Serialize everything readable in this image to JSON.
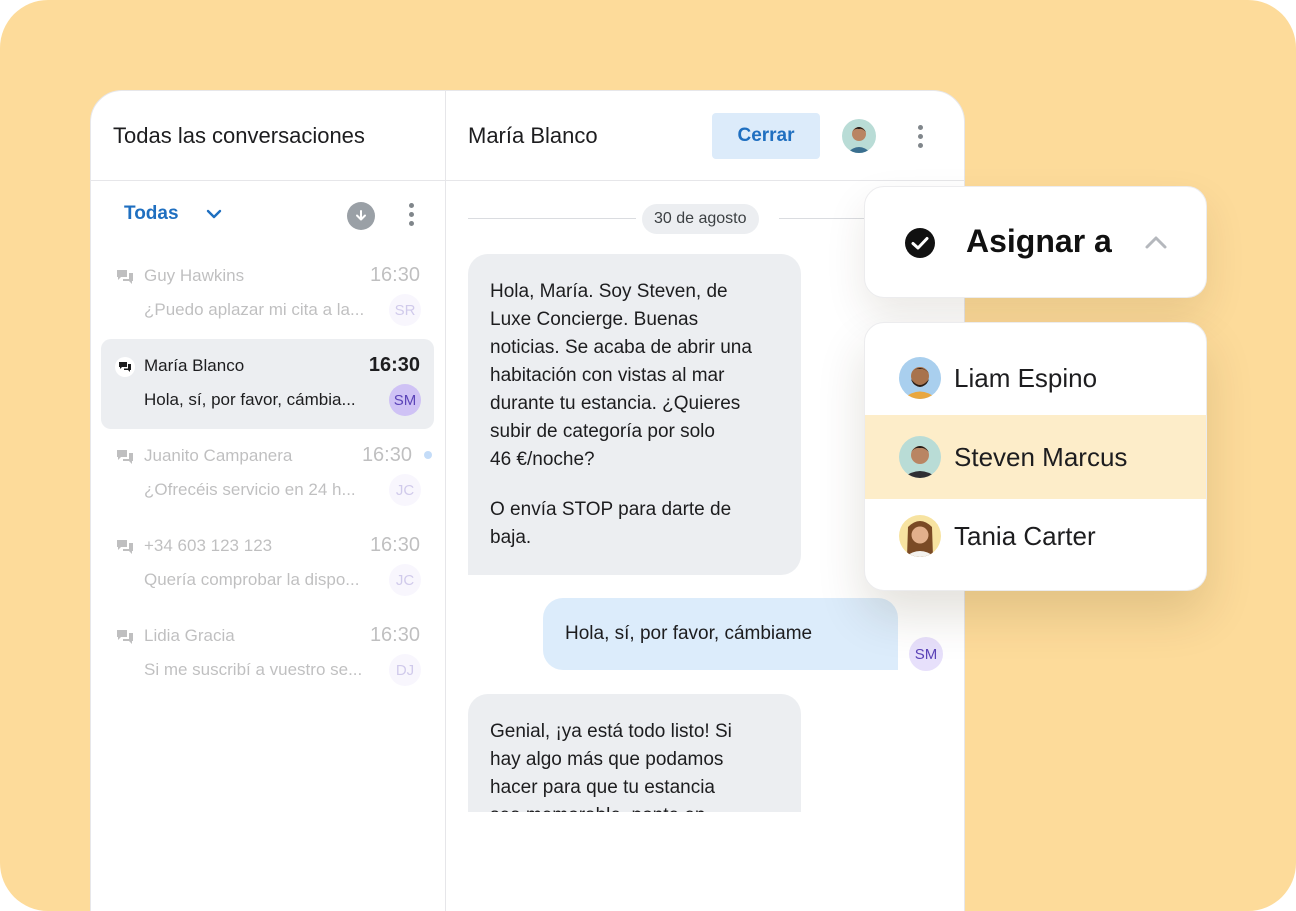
{
  "conversations_header": {
    "title": "Todas las conversaciones"
  },
  "filter": {
    "label": "Todas",
    "chevron_icon": "chevron-down-icon",
    "download_icon": "download-icon",
    "more_icon": "more-vertical-icon"
  },
  "conversations": [
    {
      "name": "Guy Hawkins",
      "time": "16:30",
      "preview": "¿Puedo aplazar mi cita a la...",
      "initials": "SR",
      "selected": false,
      "unread": false
    },
    {
      "name": "María Blanco",
      "time": "16:30",
      "preview": "Hola, sí, por favor, cámbia...",
      "initials": "SM",
      "selected": true,
      "unread": false
    },
    {
      "name": "Juanito Campanera",
      "time": "16:30",
      "preview": "¿Ofrecéis servicio en 24 h...",
      "initials": "JC",
      "selected": false,
      "unread": true
    },
    {
      "name": "+34 603 123 123",
      "time": "16:30",
      "preview": "Quería comprobar la dispo...",
      "initials": "JC",
      "selected": false,
      "unread": false
    },
    {
      "name": "Lidia Gracia",
      "time": "16:30",
      "preview": "Si me suscribí a vuestro se...",
      "initials": "DJ",
      "selected": false,
      "unread": false
    }
  ],
  "chat_header": {
    "contact_name": "María Blanco",
    "close_label": "Cerrar",
    "avatar_icon": "agent-avatar",
    "more_icon": "more-vertical-icon"
  },
  "messages": {
    "date": "30 de agosto",
    "items": [
      {
        "direction": "in",
        "paragraphs": [
          "Hola, María. Soy Steven, de\nLuxe Concierge. Buenas\nnoticias. Se acaba de abrir una\nhabitación con vistas al mar\ndurante tu estancia. ¿Quieres\nsubir de categoría por solo\n46 €/noche?",
          "O envía STOP para darte de\nbaja."
        ]
      },
      {
        "direction": "out",
        "paragraphs": [
          "Hola, sí, por favor, cámbiame"
        ],
        "initials": "SM"
      },
      {
        "direction": "in",
        "paragraphs": [
          "Genial, ¡ya está todo listo! Si\nhay algo más que podamos\nhacer para que tu estancia\nsea memorable, ponte en"
        ]
      }
    ]
  },
  "assign": {
    "label": "Asignar a",
    "check_icon": "check-circle-icon",
    "chevron_icon": "chevron-up-icon",
    "agents": [
      {
        "name": "Liam Espino",
        "highlighted": false
      },
      {
        "name": "Steven Marcus",
        "highlighted": true
      },
      {
        "name": "Tania Carter",
        "highlighted": false
      }
    ]
  },
  "colors": {
    "background": "#fddb9a",
    "accent": "#1f6fc0",
    "selected_row": "#eceef1",
    "agent_highlight": "#fdedc9"
  }
}
